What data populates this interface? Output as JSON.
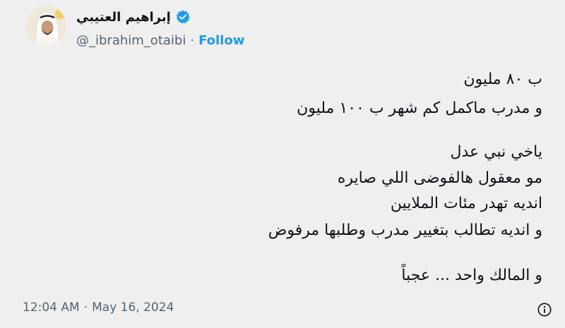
{
  "author": {
    "display_name": "إبراهيم العتيبي",
    "handle": "@_ibrahim_otaibi",
    "separator": "·",
    "follow_label": "Follow",
    "verified_badge_icon": "verified-badge-icon",
    "accent_color": "#1d9bf0"
  },
  "tweet": {
    "lines": [
      "ب ٨٠ مليون",
      "و مدرب ماكمل كم شهر ب ١٠٠ مليون",
      "ياخي نبي عدل",
      "مو معقول هالفوضى اللي صايره",
      "انديه تهدر مئات الملايين",
      "و انديه تطالب بتغيير مدرب وطلبها مرفوض",
      "و المالك واحد  ...  عجباً"
    ]
  },
  "footer": {
    "time": "12:04 AM",
    "separator": "·",
    "date": "May 16, 2024",
    "info_icon": "info-icon"
  }
}
